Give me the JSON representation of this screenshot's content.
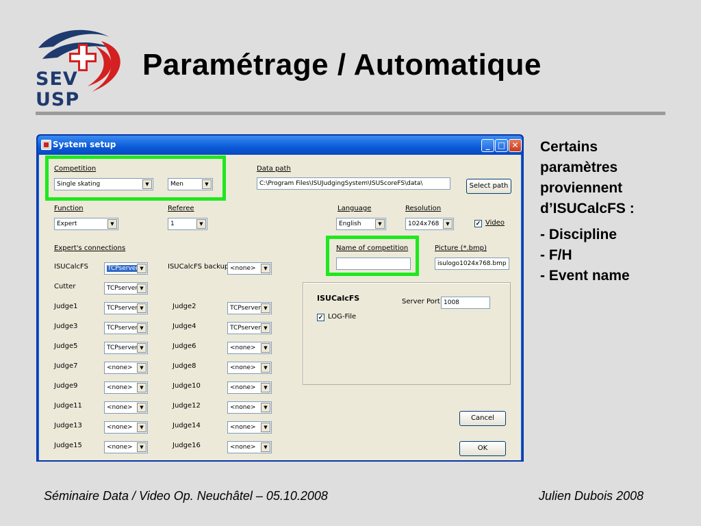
{
  "slide": {
    "title": "Paramétrage / Automatique",
    "logo_top": "SEV",
    "logo_bottom": "USP",
    "footer_left": "Séminaire Data / Video Op. Neuchâtel – 05.10.2008",
    "footer_right": "Julien Dubois 2008",
    "notes": {
      "line1": "Certains",
      "line2": "paramètres",
      "line3": "proviennent",
      "line4": "d’ISUCalcFS :",
      "item1": "- Discipline",
      "item2": "- F/H",
      "item3": "- Event name"
    },
    "colors": {
      "highlight": "#1ee81e",
      "logo_blue": "#1e3a6e",
      "logo_red": "#d42020"
    }
  },
  "window": {
    "title": "System setup",
    "minimize": "_",
    "maximize": "□",
    "close": "✕",
    "competition": {
      "label": "Competition",
      "value": "Single skating",
      "gender": "Men"
    },
    "data_path": {
      "label": "Data path",
      "value": "C:\\Program Files\\ISUJudgingSystem\\ISUScoreFS\\data\\",
      "button": "Select path"
    },
    "function": {
      "label": "Function",
      "value": "Expert"
    },
    "referee": {
      "label": "Referee",
      "value": "1"
    },
    "language": {
      "label": "Language",
      "value": "English"
    },
    "resolution": {
      "label": "Resolution",
      "value": "1024x768"
    },
    "video": {
      "label": "Video",
      "checked": "✓"
    },
    "experts": {
      "label": "Expert's connections"
    },
    "name_of_competition": {
      "label": "Name of competition",
      "value": ""
    },
    "picture": {
      "label": "Picture (*.bmp)",
      "value": "isulogo1024x768.bmp"
    },
    "connections": {
      "isucalcfs": {
        "label": "ISUCalcFS",
        "value": "TCPserver"
      },
      "isucalcfs_backup": {
        "label": "ISUCalcFS backup",
        "value": "<none>"
      },
      "cutter": {
        "label": "Cutter",
        "value": "TCPserver"
      },
      "judge1": {
        "label": "Judge1",
        "value": "TCPserver"
      },
      "judge2": {
        "label": "Judge2",
        "value": "TCPserver"
      },
      "judge3": {
        "label": "Judge3",
        "value": "TCPserver"
      },
      "judge4": {
        "label": "Judge4",
        "value": "TCPserver"
      },
      "judge5": {
        "label": "Judge5",
        "value": "TCPserver"
      },
      "judge6": {
        "label": "Judge6",
        "value": "<none>"
      },
      "judge7": {
        "label": "Judge7",
        "value": "<none>"
      },
      "judge8": {
        "label": "Judge8",
        "value": "<none>"
      },
      "judge9": {
        "label": "Judge9",
        "value": "<none>"
      },
      "judge10": {
        "label": "Judge10",
        "value": "<none>"
      },
      "judge11": {
        "label": "Judge11",
        "value": "<none>"
      },
      "judge12": {
        "label": "Judge12",
        "value": "<none>"
      },
      "judge13": {
        "label": "Judge13",
        "value": "<none>"
      },
      "judge14": {
        "label": "Judge14",
        "value": "<none>"
      },
      "judge15": {
        "label": "Judge15",
        "value": "<none>"
      },
      "judge16": {
        "label": "Judge16",
        "value": "<none>"
      }
    },
    "isucalc_panel": {
      "title": "ISUCalcFS",
      "port_label": "Server Port",
      "port_value": "1008",
      "log_label": "LOG-File",
      "log_checked": "✓"
    },
    "buttons": {
      "cancel": "Cancel",
      "ok": "OK"
    },
    "dropdown_arrow": "▼"
  }
}
